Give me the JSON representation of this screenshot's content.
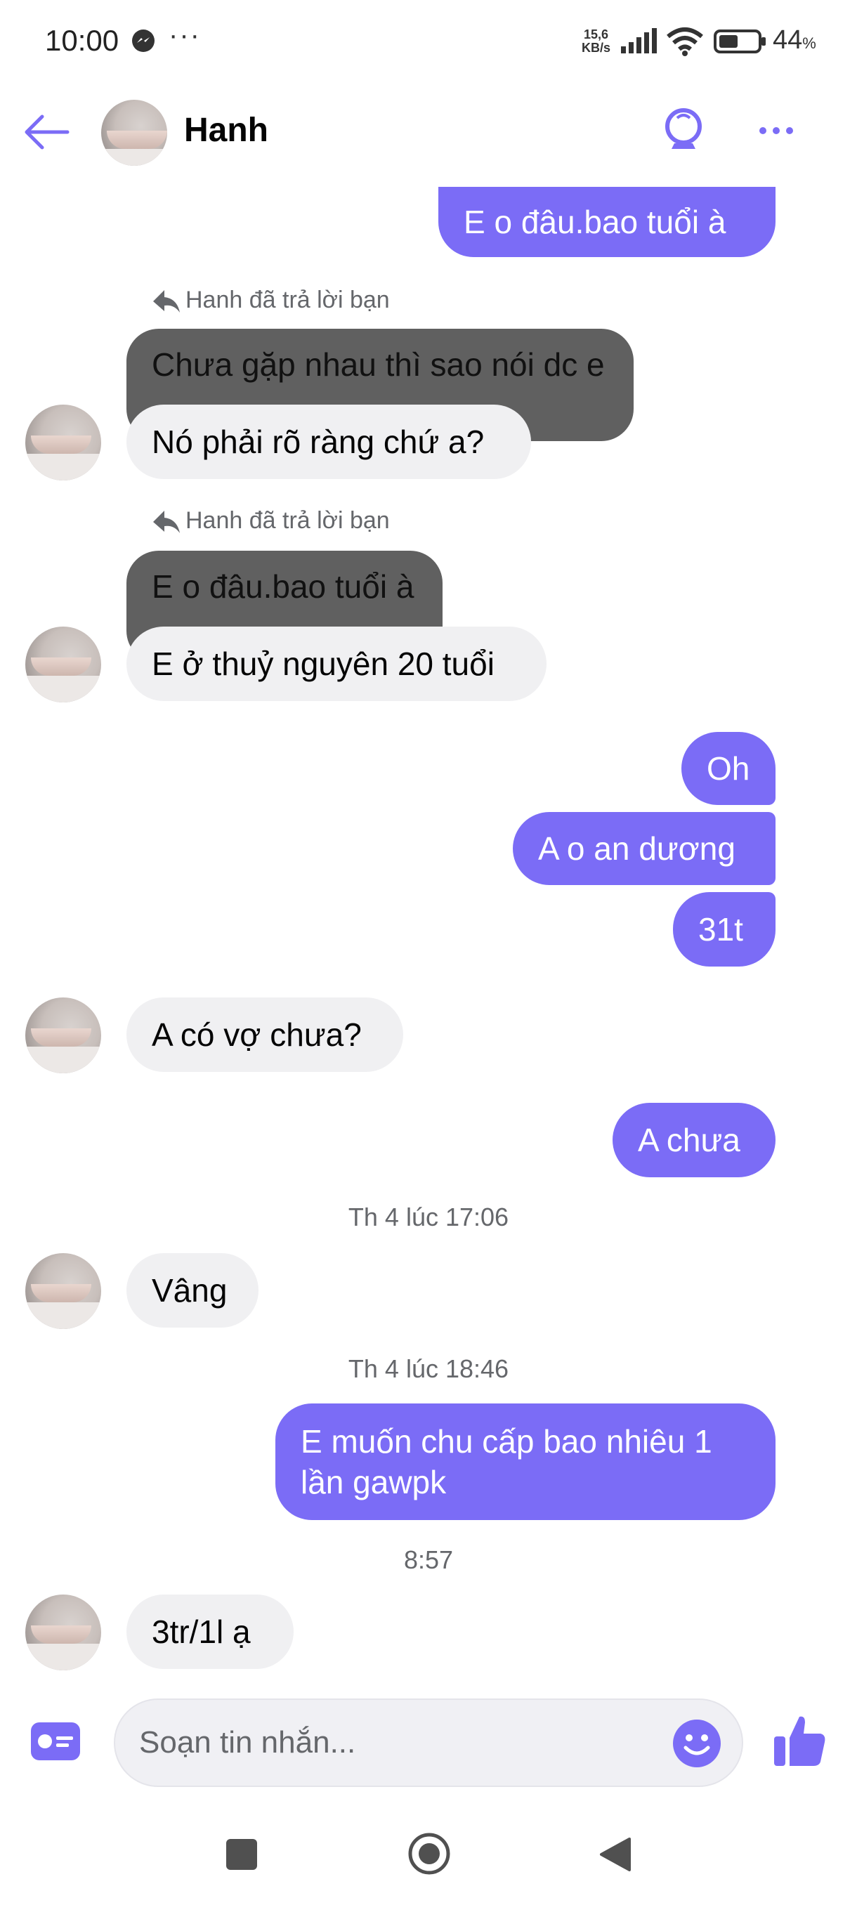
{
  "status_bar": {
    "time": "10:00",
    "dots": "···",
    "speed_value": "15,6",
    "speed_unit": "KB/s",
    "battery_pct": "44",
    "battery_unit": "%"
  },
  "header": {
    "contact_name": "Hanh"
  },
  "messages": [
    {
      "kind": "out",
      "text": "E o đâu.bao tuổi à"
    },
    {
      "kind": "reply_label",
      "text": "Hanh đã trả lời bạn"
    },
    {
      "kind": "quoted",
      "text": "Chưa gặp nhau thì sao nói dc e"
    },
    {
      "kind": "inc",
      "text": "Nó phải rõ ràng chứ a?"
    },
    {
      "kind": "reply_label",
      "text": "Hanh đã trả lời bạn"
    },
    {
      "kind": "quoted",
      "text": "E o đâu.bao tuổi à"
    },
    {
      "kind": "inc",
      "text": "E ở thuỷ nguyên 20 tuổi"
    },
    {
      "kind": "out",
      "text": "Oh"
    },
    {
      "kind": "out",
      "text": "A o an dương"
    },
    {
      "kind": "out",
      "text": "31t"
    },
    {
      "kind": "inc",
      "text": "A có vợ chưa?"
    },
    {
      "kind": "out",
      "text": "A chưa"
    },
    {
      "kind": "timestamp",
      "text": "Th 4 lúc 17:06"
    },
    {
      "kind": "inc",
      "text": "Vâng"
    },
    {
      "kind": "timestamp",
      "text": "Th 4 lúc 18:46"
    },
    {
      "kind": "out",
      "text": "E muốn chu cấp bao nhiêu 1 lần gawpk"
    },
    {
      "kind": "timestamp",
      "text": "8:57"
    },
    {
      "kind": "inc",
      "text": "3tr/1l ạ"
    }
  ],
  "composer": {
    "placeholder": "Soạn tin nhắn..."
  },
  "colors": {
    "accent": "#7b6cf6",
    "incoming_bubble": "#f0f0f2",
    "quoted_bubble": "#606060"
  },
  "icons": [
    "messenger-icon",
    "signal-icon",
    "wifi-icon",
    "battery-icon",
    "back-arrow-icon",
    "lightbulb-icon",
    "more-icon",
    "contact-card-icon",
    "emoji-icon",
    "thumbs-up-icon",
    "reply-arrow-icon"
  ]
}
